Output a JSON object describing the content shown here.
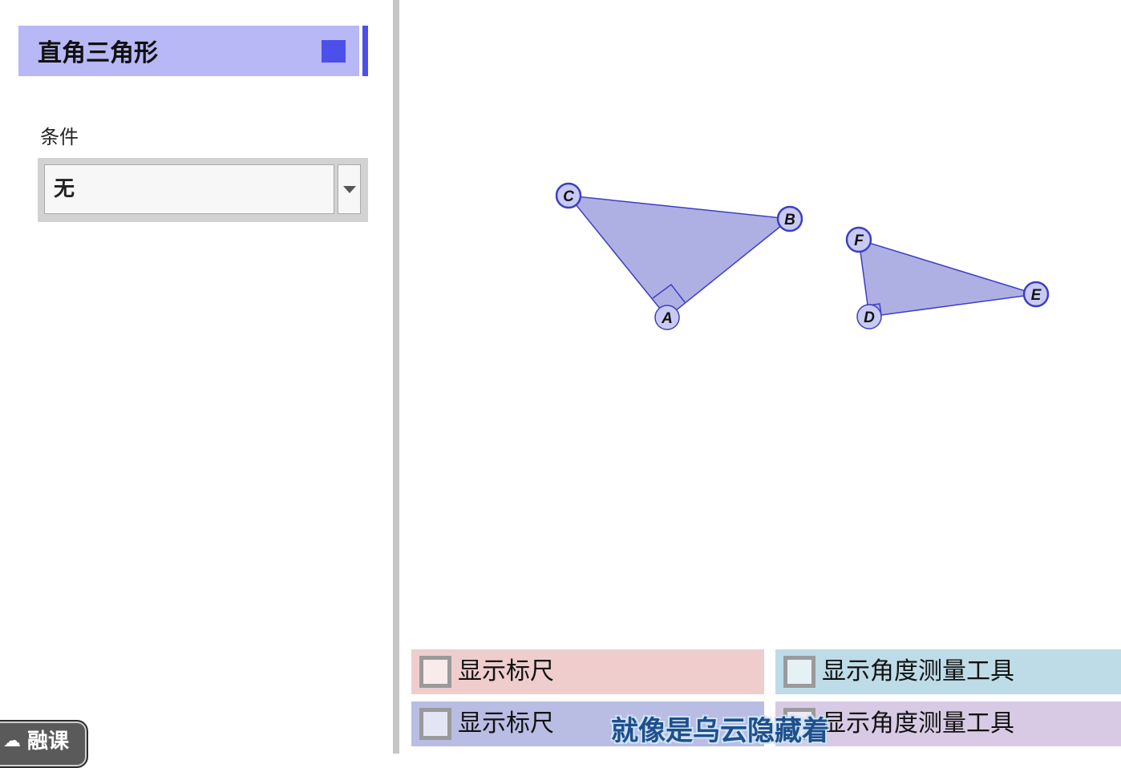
{
  "algebra": {
    "object_label": "直角三角形",
    "object_color": "#4c4fea",
    "condition_label": "条件",
    "condition_value": "无"
  },
  "graphics": {
    "fill_color": "#aeb0e4",
    "stroke_color": "#3d3fc0",
    "point_fill": "#c9caf4",
    "triangle_1": {
      "vertices": [
        "A",
        "B",
        "C"
      ],
      "right_angle_at": "A"
    },
    "triangle_2": {
      "vertices": [
        "D",
        "E",
        "F"
      ],
      "right_angle_at": "D"
    },
    "checkboxes": [
      {
        "label": "显示标尺",
        "bg": "#efcdcd",
        "checked": false
      },
      {
        "label": "显示角度测量工具",
        "bg": "#bddce7",
        "checked": false
      },
      {
        "label": "显示标尺",
        "bg": "#b9bde4",
        "checked": false
      },
      {
        "label": "显示角度测量工具",
        "bg": "#d8cae4",
        "checked": false
      }
    ]
  },
  "overlay": {
    "subtitle": "就像是乌云隐藏着",
    "brand": "融课"
  }
}
